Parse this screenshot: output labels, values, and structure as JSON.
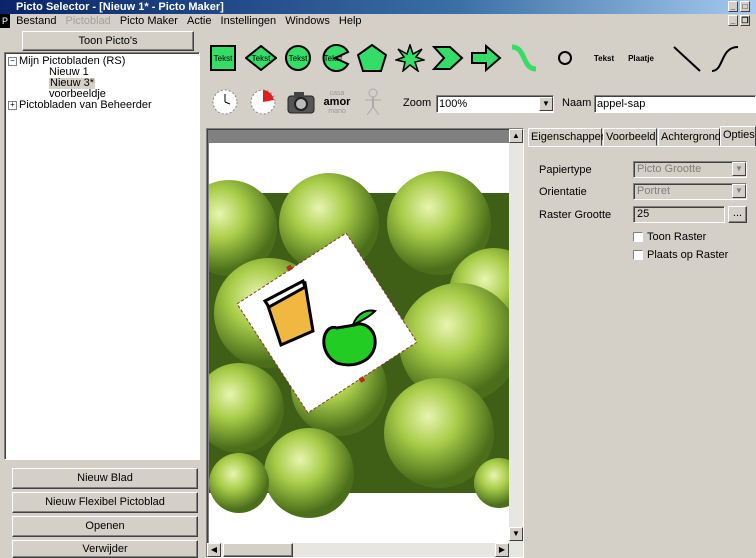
{
  "window": {
    "title": "Picto Selector - [Nieuw 1* - Picto Maker]"
  },
  "menu": [
    {
      "label": "Bestand",
      "disabled": false
    },
    {
      "label": "Pictoblad",
      "disabled": true
    },
    {
      "label": "Picto Maker",
      "disabled": false
    },
    {
      "label": "Actie",
      "disabled": false
    },
    {
      "label": "Instellingen",
      "disabled": false
    },
    {
      "label": "Windows",
      "disabled": false
    },
    {
      "label": "Help",
      "disabled": false
    }
  ],
  "left": {
    "toon_label": "Toon Picto's",
    "tree": {
      "root1": "Mijn Pictobladen (RS)",
      "child1": "Nieuw 1",
      "child2": "Nieuw 3*",
      "child3": "voorbeeldje",
      "root2": "Pictobladen van Beheerder"
    },
    "buttons": {
      "nieuw_blad": "Nieuw Blad",
      "nieuw_flexibel": "Nieuw Flexibel Pictoblad",
      "openen": "Openen",
      "verwijder": "Verwijder"
    }
  },
  "toolbar": {
    "shape_labels": {
      "tekst": "Tekst",
      "diamond": "Tekst",
      "circle": "Tekst",
      "pacman": "Tekst"
    },
    "plain_tekst": "Tekst",
    "plaatje": "Plaatje",
    "amor": {
      "top": "casa",
      "main": "amor",
      "bottom": "mano"
    },
    "zoom_label": "Zoom",
    "zoom_value": "100%",
    "naam_label": "Naam",
    "naam_value": "appel-sap",
    "colors": {
      "shape_fill": "#33dd66",
      "shape_stroke": "#000000"
    }
  },
  "tabs": [
    {
      "label": "Eigenschappen",
      "active": false
    },
    {
      "label": "Voorbeeld",
      "active": false
    },
    {
      "label": "Achtergrond",
      "active": false
    },
    {
      "label": "Opties",
      "active": true
    }
  ],
  "options": {
    "papiertype_label": "Papiertype",
    "papiertype_value": "Picto Grootte",
    "orientatie_label": "Orientatie",
    "orientatie_value": "Portret",
    "raster_label": "Raster Grootte",
    "raster_value": "25",
    "raster_btn": "...",
    "toon_raster": "Toon Raster",
    "plaats_op_raster": "Plaats op Raster"
  }
}
